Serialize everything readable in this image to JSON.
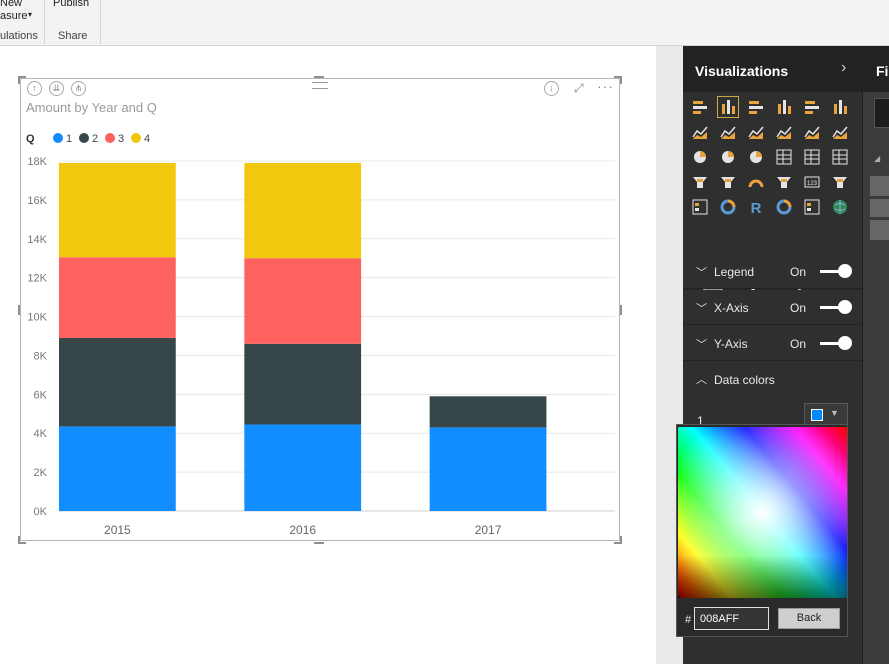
{
  "ribbon": {
    "new_measure_line1": "New",
    "new_measure_line2": "asure",
    "publish": "Publish",
    "group_calculations": "ulations",
    "group_share": "Share"
  },
  "visual": {
    "title": "Amount by Year and Q",
    "legend_title": "Q"
  },
  "chart_data": {
    "type": "bar",
    "stacked": true,
    "title": "Amount by Year and Q",
    "categories": [
      "2015",
      "2016",
      "2017"
    ],
    "legend_title": "Q",
    "legend_position": "top-left",
    "series": [
      {
        "name": "1",
        "color": "#118DFF",
        "values": [
          4350,
          4450,
          4300
        ]
      },
      {
        "name": "2",
        "color": "#374649",
        "values": [
          4550,
          4150,
          1600
        ]
      },
      {
        "name": "3",
        "color": "#FD625E",
        "values": [
          4150,
          4400,
          0
        ]
      },
      {
        "name": "4",
        "color": "#F2C80F",
        "values": [
          4850,
          4900,
          0
        ]
      }
    ],
    "y_ticks": [
      "0K",
      "2K",
      "4K",
      "6K",
      "8K",
      "10K",
      "12K",
      "14K",
      "16K",
      "18K"
    ],
    "ylim": [
      0,
      18000
    ],
    "grid": true
  },
  "viz_pane": {
    "title": "Visualizations",
    "sections": [
      {
        "label": "Legend",
        "state": "On"
      },
      {
        "label": "X-Axis",
        "state": "On"
      },
      {
        "label": "Y-Axis",
        "state": "On"
      }
    ],
    "data_colors_label": "Data colors",
    "data_colors_item": "1",
    "selected_color": "#008AFF"
  },
  "color_picker": {
    "hash": "#",
    "hex_value": "008AFF",
    "back_label": "Back"
  },
  "filters_pane": {
    "title": "Fi"
  },
  "colors": {
    "series_1": "#118DFF",
    "series_2": "#374649",
    "series_3": "#FD625E",
    "series_4": "#F2C80F",
    "accent": "#F2C811",
    "pane_bg": "#2F2F2F"
  }
}
